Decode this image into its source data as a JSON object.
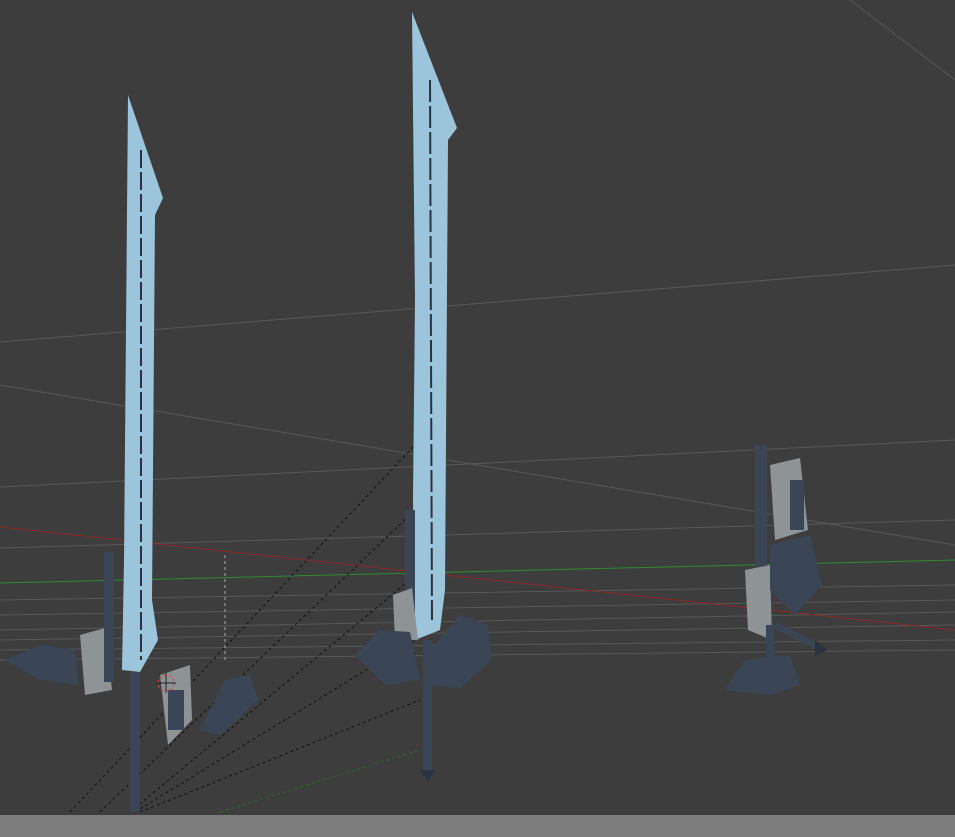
{
  "viewport": {
    "background": "#3d3d3d",
    "grid_color": "#5a5a5a",
    "x_axis_color": "#8a2a2a",
    "y_axis_color": "#2f8a2f",
    "blade_color": "#9cc4da",
    "blade_groove_color": "#2c3340",
    "hilt_color": "#3a4556",
    "guard_plate_color": "#8e9396",
    "selected_object": "3d-cursor"
  },
  "statusbar": {
    "color": "#7d7d7d"
  },
  "objects": [
    {
      "name": "sword-left"
    },
    {
      "name": "sword-middle"
    },
    {
      "name": "sword-parts-right"
    }
  ]
}
